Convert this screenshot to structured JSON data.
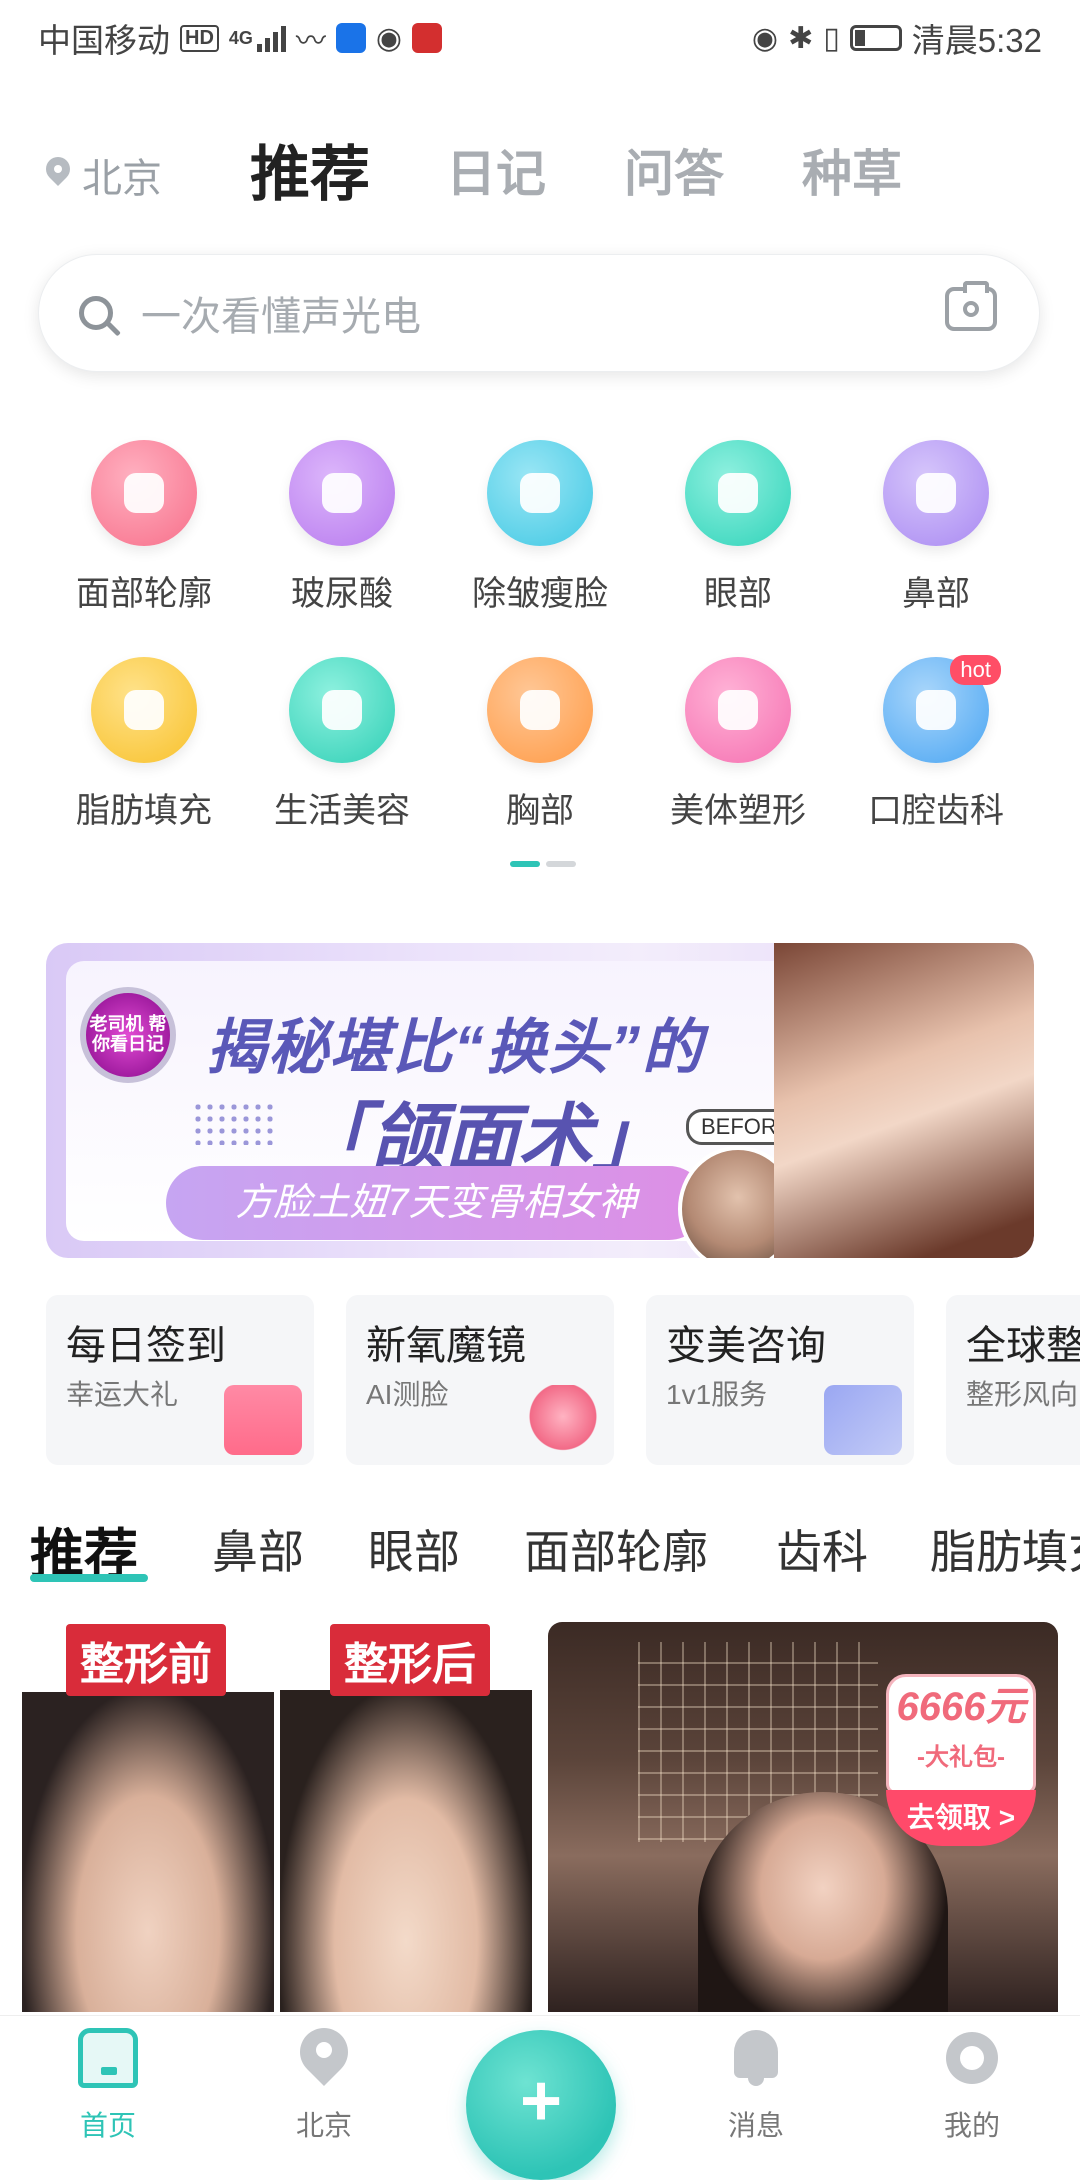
{
  "status_bar": {
    "carrier": "中国移动",
    "hd": "HD",
    "network": "4G",
    "time_label": "清晨5:32"
  },
  "top_nav": {
    "location": "北京",
    "tabs": [
      "推荐",
      "日记",
      "问答",
      "种草"
    ],
    "active_tab": "推荐"
  },
  "search": {
    "placeholder": "一次看懂声光电"
  },
  "categories": [
    {
      "label": "面部轮廓",
      "icon": "face-contour-icon",
      "color": "#f76f8a"
    },
    {
      "label": "玻尿酸",
      "icon": "syringe-icon",
      "color": "#b779ee"
    },
    {
      "label": "除皱瘦脸",
      "icon": "jar-icon",
      "color": "#40c8e3"
    },
    {
      "label": "眼部",
      "icon": "eye-icon",
      "color": "#2fd3b9"
    },
    {
      "label": "鼻部",
      "icon": "nose-icon",
      "color": "#a989f2"
    },
    {
      "label": "脂肪填充",
      "icon": "drop-icon",
      "color": "#f8c12b"
    },
    {
      "label": "生活美容",
      "icon": "mask-icon",
      "color": "#2fcfb5"
    },
    {
      "label": "胸部",
      "icon": "bra-icon",
      "color": "#ff9a45"
    },
    {
      "label": "美体塑形",
      "icon": "body-icon",
      "color": "#f56fb0"
    },
    {
      "label": "口腔齿科",
      "icon": "tooth-icon",
      "color": "#4aa5f2",
      "badge": "hot"
    }
  ],
  "pager": {
    "active_color": "#2ec4b6",
    "inactive_color": "#d4d7da"
  },
  "banner": {
    "logo_text": "老司机 帮你看日记",
    "headline": "揭秘堪比“换头”的",
    "title": "「颌面术」",
    "tagline": "方脸土妞7天变骨相女神",
    "before_label": "BEFORE"
  },
  "quick_cards": [
    {
      "title": "每日签到",
      "subtitle": "幸运大礼",
      "icon": "gift-icon"
    },
    {
      "title": "新氧魔镜",
      "subtitle": "AI测脸",
      "icon": "mirror-face-icon"
    },
    {
      "title": "变美咨询",
      "subtitle": "1v1服务",
      "icon": "chat-icon"
    },
    {
      "title": "全球整",
      "subtitle": "整形风向",
      "icon": "globe-icon"
    }
  ],
  "content_tabs": [
    "推荐",
    "鼻部",
    "眼部",
    "面部轮廓",
    "齿科",
    "脂肪填充"
  ],
  "feed": {
    "left": {
      "tag_before": "整形前",
      "tag_after": "整形后"
    },
    "right": {
      "gift_amount": "6666元",
      "gift_name": "-大礼包-",
      "gift_button": "去领取 >"
    }
  },
  "bottom_nav": [
    {
      "label": "首页",
      "icon": "home-icon",
      "active": true
    },
    {
      "label": "北京",
      "icon": "map-pin-icon",
      "active": false
    },
    {
      "label": "消息",
      "icon": "bell-icon",
      "active": false
    },
    {
      "label": "我的",
      "icon": "profile-icon",
      "active": false
    }
  ],
  "plus_button": "+",
  "accent_color": "#2ec4b6"
}
